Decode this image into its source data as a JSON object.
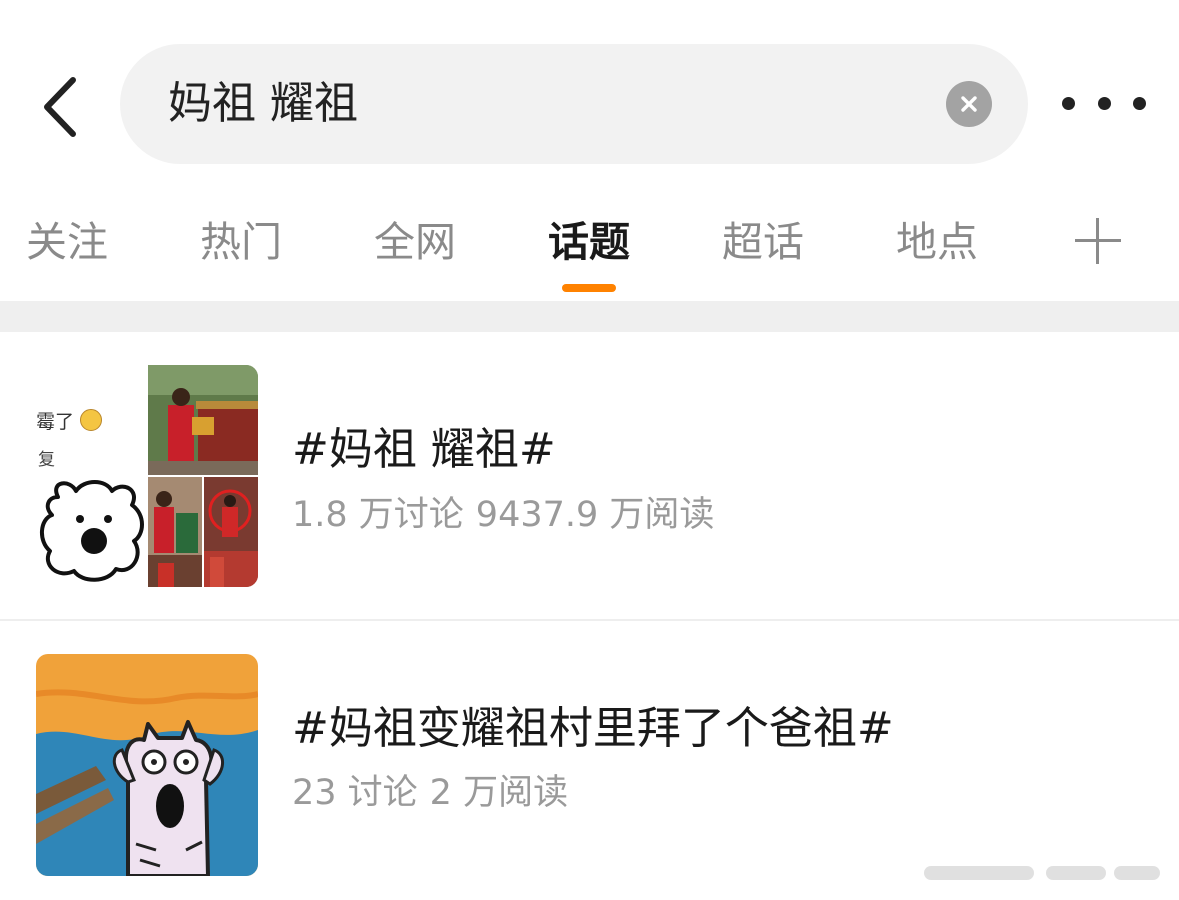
{
  "search": {
    "query": "妈祖 耀祖"
  },
  "tabs": [
    {
      "label": "关注",
      "active": false
    },
    {
      "label": "热门",
      "active": false
    },
    {
      "label": "全网",
      "active": false
    },
    {
      "label": "话题",
      "active": true
    },
    {
      "label": "超话",
      "active": false
    },
    {
      "label": "地点",
      "active": false
    }
  ],
  "colors": {
    "accent": "#ff8200",
    "text_primary": "#1a1a1a",
    "text_secondary": "#9a9a9a",
    "search_bg": "#f2f2f2"
  },
  "icons": {
    "back": "chevron-left-icon",
    "clear": "clear-icon",
    "more": "more-horizontal-icon",
    "add_tab": "plus-icon"
  },
  "topics": [
    {
      "title": "#妈祖 耀祖#",
      "discussions": "1.8 万讨论",
      "reads": "9437.9 万阅读",
      "thumb_caption_1": "霉了",
      "thumb_caption_2": "复"
    },
    {
      "title": "#妈祖变耀祖村里拜了个爸祖#",
      "discussions": "23 讨论",
      "reads": "2 万阅读"
    }
  ]
}
